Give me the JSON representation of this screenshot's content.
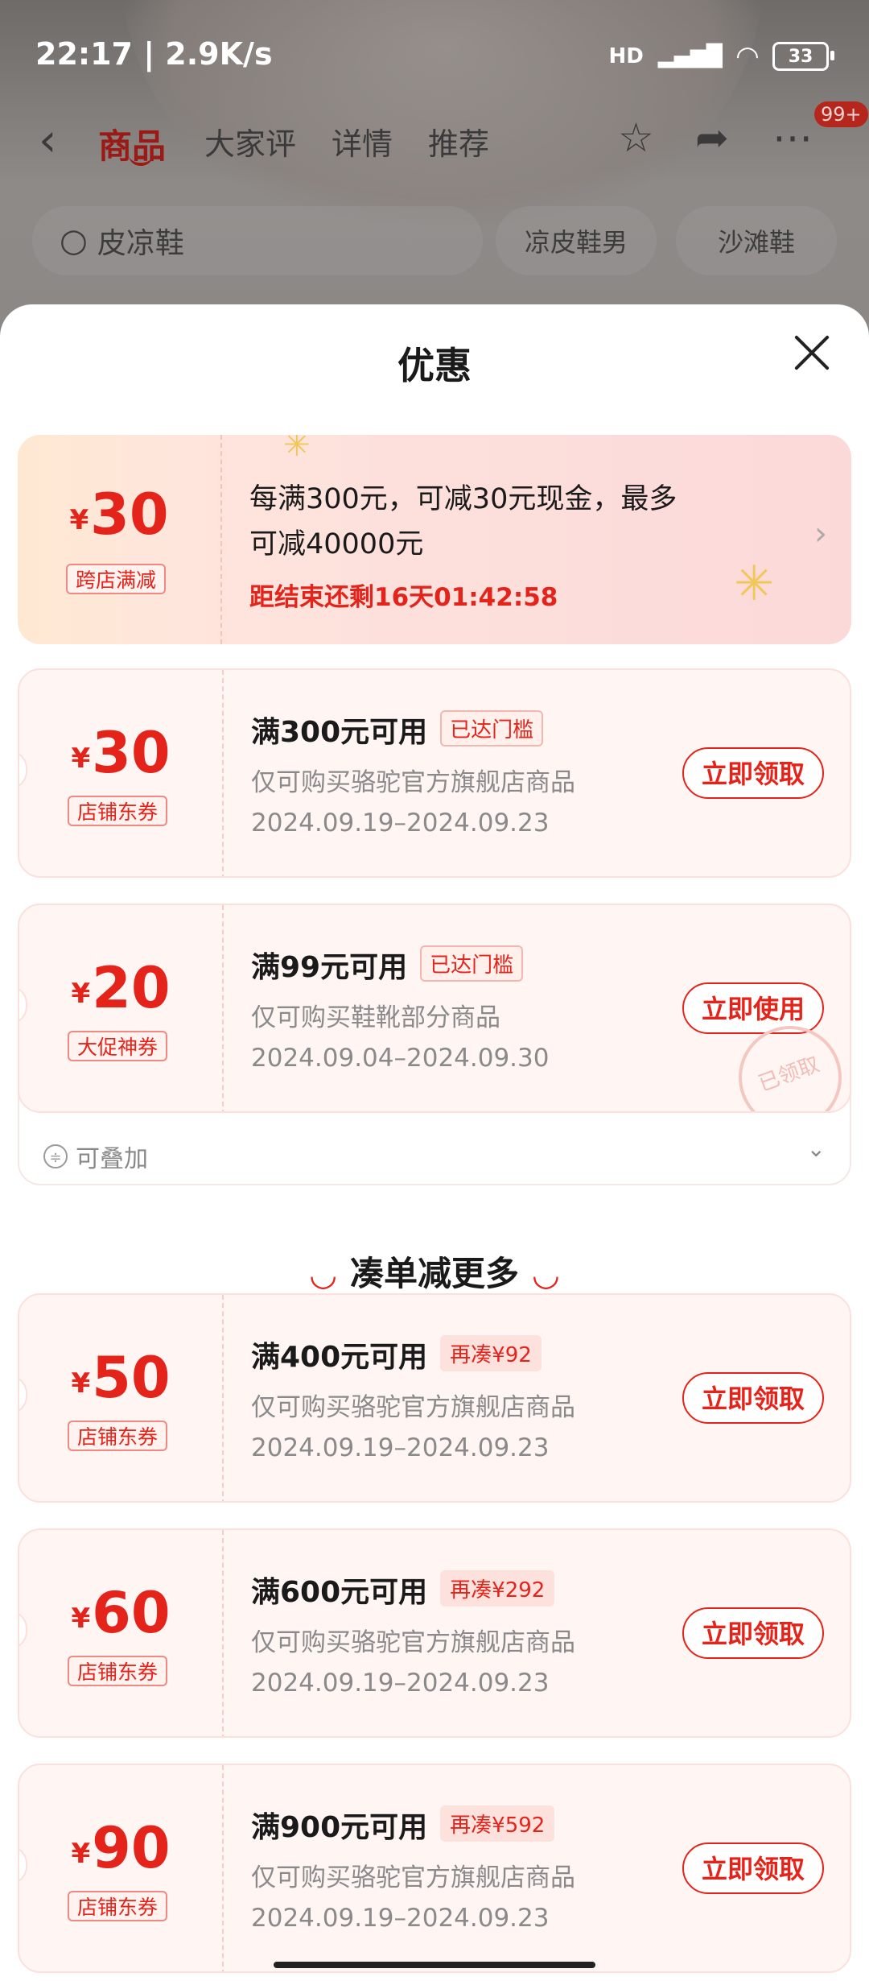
{
  "status_bar": {
    "time": "22:17 | 2.9K/s",
    "network": "HD",
    "battery": "33"
  },
  "top_nav": {
    "tabs": [
      "商品",
      "大家评",
      "详情",
      "推荐"
    ],
    "badge": "99+"
  },
  "search": {
    "placeholder": "皮凉鞋",
    "chips": [
      "凉皮鞋男",
      "沙滩鞋"
    ]
  },
  "sheet": {
    "title": "优惠"
  },
  "promo": {
    "symbol": "¥",
    "amount": "30",
    "type": "跨店满减",
    "line1": "每满300元，可减30元现金，最多",
    "line2": "可减40000元",
    "countdown": "距结束还剩16天01:42:58"
  },
  "coupons": [
    {
      "symbol": "¥",
      "amount": "30",
      "type": "店铺东券",
      "title": "满300元可用",
      "tag": "已达门槛",
      "scope": "仅可购买骆驼官方旗舰店商品",
      "date": "2024.09.19–2024.09.23",
      "button": "立即领取"
    },
    {
      "symbol": "¥",
      "amount": "20",
      "type": "大促神券",
      "title": "满99元可用",
      "tag": "已达门槛",
      "scope": "仅可购买鞋靴部分商品",
      "date": "2024.09.04–2024.09.30",
      "button": "立即使用",
      "stamp": "已领取"
    },
    {
      "symbol": "¥",
      "amount": "50",
      "type": "店铺东券",
      "title": "满400元可用",
      "tag": "再凑¥92",
      "scope": "仅可购买骆驼官方旗舰店商品",
      "date": "2024.09.19–2024.09.23",
      "button": "立即领取"
    },
    {
      "symbol": "¥",
      "amount": "60",
      "type": "店铺东券",
      "title": "满600元可用",
      "tag": "再凑¥292",
      "scope": "仅可购买骆驼官方旗舰店商品",
      "date": "2024.09.19–2024.09.23",
      "button": "立即领取"
    },
    {
      "symbol": "¥",
      "amount": "90",
      "type": "店铺东券",
      "title": "满900元可用",
      "tag": "再凑¥592",
      "scope": "仅可购买骆驼官方旗舰店商品",
      "date": "2024.09.19–2024.09.23",
      "button": "立即领取"
    }
  ],
  "stackable_label": "可叠加",
  "section_title": "凑单减更多",
  "colors": {
    "accent": "#e4241b",
    "card_bg": "#fff5f3"
  },
  "icons": [
    "back-icon",
    "star-icon",
    "share-icon",
    "more-icon",
    "search-icon",
    "close-icon",
    "chevron-right-icon",
    "stack-icon",
    "chevron-down-icon"
  ]
}
